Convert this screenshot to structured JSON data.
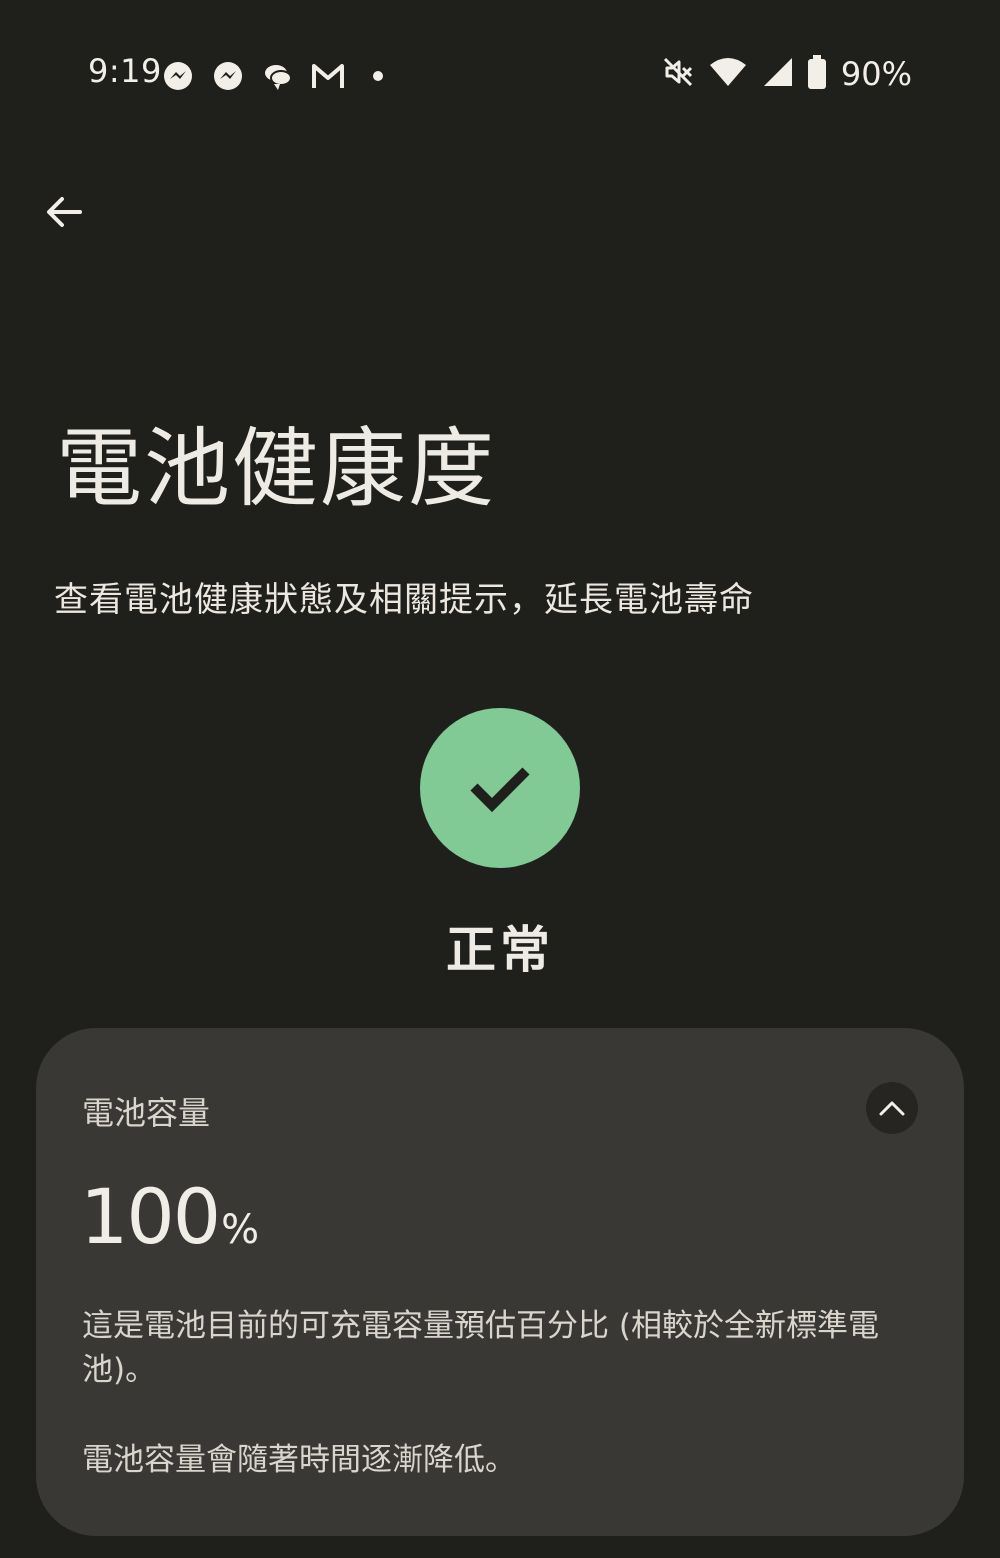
{
  "status_bar": {
    "time": "9:19",
    "left_icons": [
      "messenger-icon",
      "messenger-icon",
      "chat-icon",
      "gmail-icon",
      "dot-icon"
    ],
    "right_icons": [
      "mute-icon",
      "wifi-icon",
      "signal-icon",
      "battery-icon"
    ],
    "battery_percent": "90%"
  },
  "header": {
    "title": "電池健康度",
    "subtitle": "查看電池健康狀態及相關提示，延長電池壽命"
  },
  "health_status": {
    "label": "正常",
    "color": "#81c995",
    "icon": "check-icon"
  },
  "capacity_card": {
    "title": "電池容量",
    "value": "100",
    "unit": "%",
    "description": "這是電池目前的可充電容量預估百分比 (相較於全新標準電池)。",
    "note": "電池容量會隨著時間逐漸降低。",
    "expanded": true
  }
}
